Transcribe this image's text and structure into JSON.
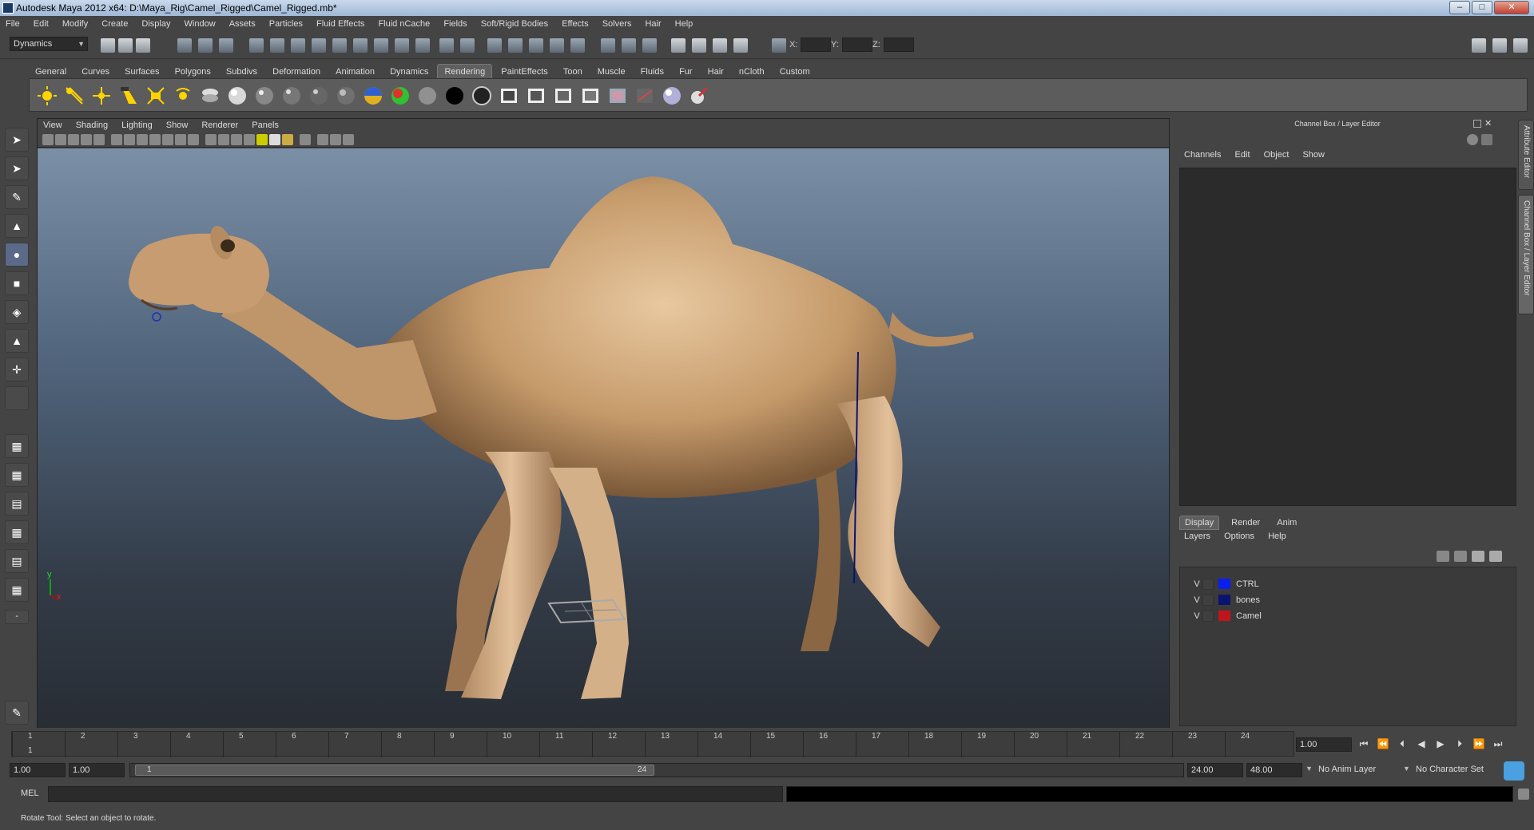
{
  "window": {
    "title": "Autodesk Maya 2012 x64: D:\\Maya_Rig\\Camel_Rigged\\Camel_Rigged.mb*"
  },
  "menubar": [
    "File",
    "Edit",
    "Modify",
    "Create",
    "Display",
    "Window",
    "Assets",
    "Particles",
    "Fluid Effects",
    "Fluid nCache",
    "Fields",
    "Soft/Rigid Bodies",
    "Effects",
    "Solvers",
    "Hair",
    "Help"
  ],
  "statusline": {
    "menuset": "Dynamics",
    "x_label": "X:",
    "y_label": "Y:",
    "z_label": "Z:"
  },
  "shelf": {
    "tabs": [
      "General",
      "Curves",
      "Surfaces",
      "Polygons",
      "Subdivs",
      "Deformation",
      "Animation",
      "Dynamics",
      "Rendering",
      "PaintEffects",
      "Toon",
      "Muscle",
      "Fluids",
      "Fur",
      "Hair",
      "nCloth",
      "Custom"
    ],
    "active": "Rendering"
  },
  "viewport": {
    "menu": [
      "View",
      "Shading",
      "Lighting",
      "Show",
      "Renderer",
      "Panels"
    ],
    "axis_y": "y",
    "axis_x": "x"
  },
  "channelbox": {
    "title": "Channel Box / Layer Editor",
    "menu": [
      "Channels",
      "Edit",
      "Object",
      "Show"
    ]
  },
  "layers": {
    "tabs": [
      "Display",
      "Render",
      "Anim"
    ],
    "active_tab": "Display",
    "menu": [
      "Layers",
      "Options",
      "Help"
    ],
    "rows": [
      {
        "visible": "V",
        "name": "CTRL",
        "color": "#0a1ef0"
      },
      {
        "visible": "V",
        "name": "bones",
        "color": "#0a1470"
      },
      {
        "visible": "V",
        "name": "Camel",
        "color": "#c0141e"
      }
    ]
  },
  "sidetabs": {
    "attribute_editor": "Attribute Editor",
    "channel_box": "Channel Box / Layer Editor"
  },
  "timeslider": {
    "ticks": [
      "1",
      "2",
      "3",
      "4",
      "5",
      "6",
      "7",
      "8",
      "9",
      "10",
      "11",
      "12",
      "13",
      "14",
      "15",
      "16",
      "17",
      "18",
      "19",
      "20",
      "21",
      "22",
      "23",
      "24"
    ],
    "current_frame_marker": "1",
    "current_time": "1.00"
  },
  "rangeslider": {
    "start_time": "1.00",
    "playback_start": "1.00",
    "range_start": "1",
    "range_end": "24",
    "playback_end": "24.00",
    "end_time": "48.00",
    "anim_layer": "No Anim Layer",
    "character_set": "No Character Set"
  },
  "commandline": {
    "label": "MEL"
  },
  "helpline": {
    "text": "Rotate Tool: Select an object to rotate."
  },
  "colors": {
    "panel": "#444444",
    "field": "#2b2b2b",
    "viewport_top": "#7b8fa7",
    "viewport_bottom": "#282d34",
    "camel": "#c59a6a"
  }
}
